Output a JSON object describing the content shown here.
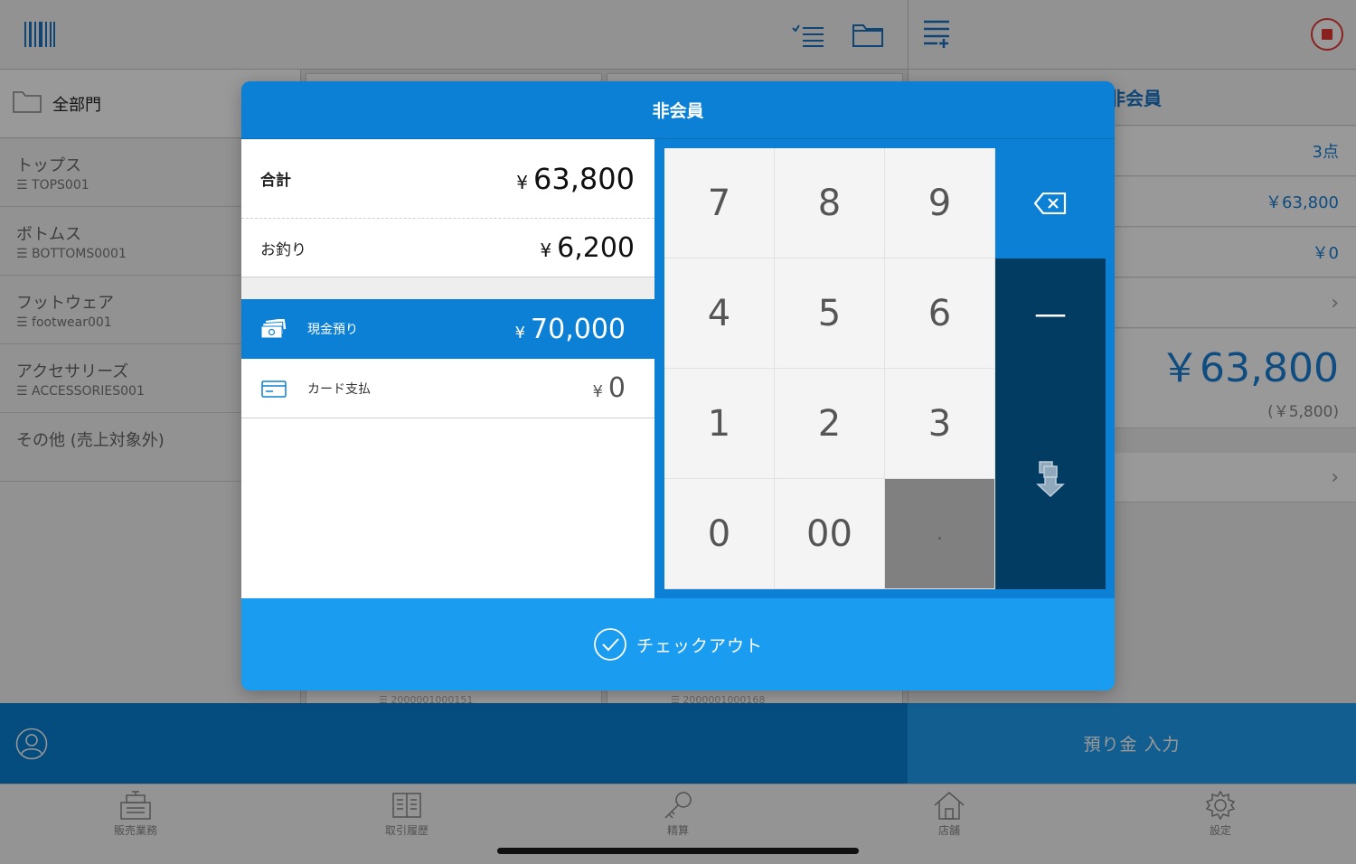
{
  "header": {
    "barcode_icon": "barcode-icon",
    "checklist_icon": "checklist-icon",
    "folder_icon": "folder-icon",
    "list_add_icon": "list-add-icon",
    "stop_icon": "stop-record-icon"
  },
  "sidebar": {
    "department_label": "全部門",
    "categories": [
      {
        "name": "トップス",
        "code": "TOPS001"
      },
      {
        "name": "ボトムス",
        "code": "BOTTOMS0001"
      },
      {
        "name": "フットウェア",
        "code": "footwear001"
      },
      {
        "name": "アクセサリーズ",
        "code": "ACCESSORIES001"
      },
      {
        "name": "その他 (売上対象外)",
        "code": ""
      }
    ]
  },
  "grid": {
    "codes": [
      "2000001000151",
      "2000001000168"
    ]
  },
  "right_panel": {
    "customer": "非会員",
    "item_count": "3点",
    "subtotal": "￥63,800",
    "discount": "￥0",
    "total": "￥63,800",
    "tax": "(￥5,800)"
  },
  "modal": {
    "title": "非会員",
    "total_label": "合計",
    "total_yen": "¥",
    "total_value": "63,800",
    "change_label": "お釣り",
    "change_yen": "¥",
    "change_value": "6,200",
    "payments": [
      {
        "label": "現金預り",
        "yen": "¥",
        "value": "70,000"
      },
      {
        "label": "カード支払",
        "yen": "¥",
        "value": "0"
      }
    ],
    "keys": [
      "7",
      "8",
      "9",
      "4",
      "5",
      "6",
      "1",
      "2",
      "3",
      "0",
      "00",
      "."
    ],
    "minus_key": "—",
    "checkout_label": "チェックアウト"
  },
  "deposit_button": "預り金 入力",
  "tabs": [
    {
      "label": "販売業務",
      "icon": "register-icon"
    },
    {
      "label": "取引履歴",
      "icon": "ledger-icon"
    },
    {
      "label": "精算",
      "icon": "key-icon"
    },
    {
      "label": "店舗",
      "icon": "store-icon"
    },
    {
      "label": "設定",
      "icon": "gear-icon"
    }
  ],
  "colors": {
    "accent": "#0b80d4",
    "accent_light": "#1a9cf0",
    "dark_key": "#033c63",
    "stop_red": "#e53935"
  }
}
